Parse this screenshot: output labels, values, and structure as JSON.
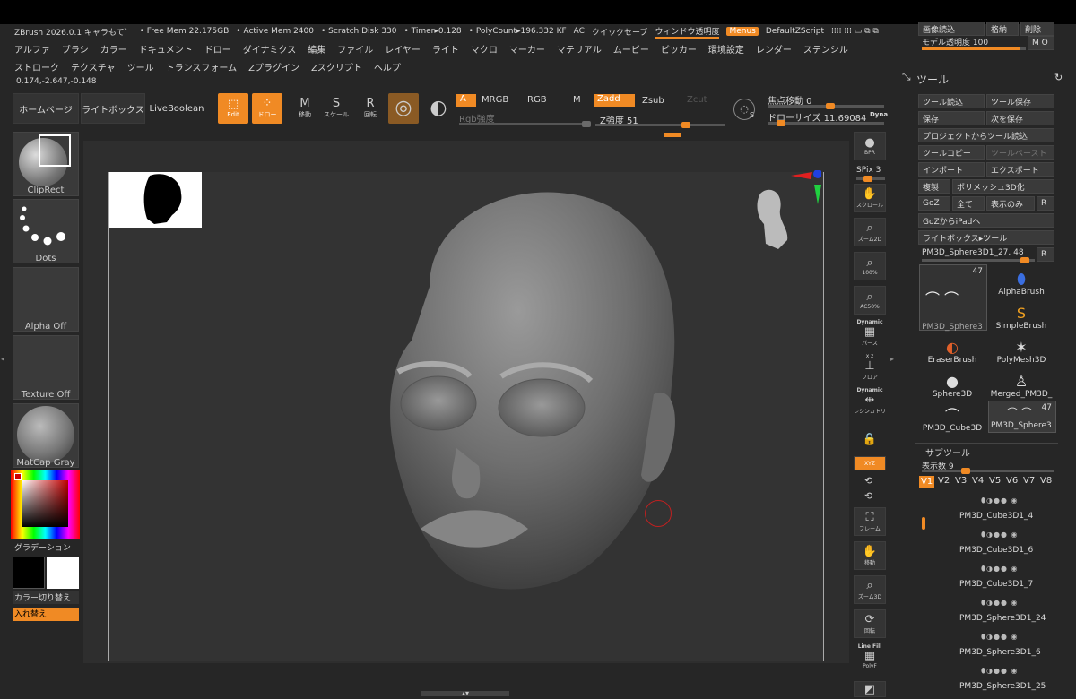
{
  "app": {
    "title": "ZBrush 2026.0.1 キャラもて゛",
    "free_mem": "• Free Mem 22.175GB",
    "active_mem": "• Active Mem 2400",
    "scratch": "• Scratch Disk 330",
    "timer": "• Timer▸0.128",
    "polycount": "• PolyCount▸196.332 KF",
    "ac": "AC",
    "quicksave": "クイックセーブ",
    "window_transparency": "ウィンドウ透明度",
    "menus": "Menus",
    "default_zscript": "DefaultZScript"
  },
  "menubar": {
    "row1": [
      "アルファ",
      "ブラシ",
      "カラー",
      "ドキュメント",
      "ドロー",
      "ダイナミクス",
      "編集",
      "ファイル",
      "レイヤー",
      "ライト",
      "マクロ",
      "マーカー",
      "マテリアル",
      "ムービー",
      "ピッカー",
      "環境設定",
      "レンダー",
      "ステンシル"
    ],
    "row2": [
      "ストローク",
      "テクスチャ",
      "ツール",
      "トランスフォーム",
      "Zプラグイン",
      "Zスクリプト",
      "ヘルプ"
    ]
  },
  "coords": "0.174,-2.647,-0.148",
  "toolbar": {
    "home": "ホームページ",
    "lightbox": "ライトボックス",
    "liveboolean": "LiveBoolean",
    "edit": "Edit",
    "draw": "ドロー",
    "move": "移動",
    "scale": "スケール",
    "rotate": "回転",
    "a": "A",
    "mrgb": "MRGB",
    "rgb": "RGB",
    "m": "M",
    "zadd": "Zadd",
    "zsub": "Zsub",
    "zcut": "Zcut",
    "rgb_intensity": "Rgb強度",
    "z_intensity": "Z強度 51",
    "focal_shift": "焦点移動 0",
    "draw_size": "ドローサイズ 11.69084",
    "dyna": "Dyna"
  },
  "left": {
    "cliprect": "ClipRect",
    "dots": "Dots",
    "alpha": "Alpha Off",
    "texture": "Texture Off",
    "matcap": "MatCap Gray",
    "gradient": "グラデーション",
    "switch_color": "カラー切り替え",
    "swap": "入れ替え"
  },
  "right_strip": {
    "bpr": "BPR",
    "spix": "SPix 3",
    "scroll": "スクロール",
    "zoom2d": "ズーム2D",
    "p100": "100%",
    "ac50": "AC50%",
    "dynamic": "Dynamic",
    "perspective": "パース",
    "floor": "フロア",
    "dynamic2": "Dynamic",
    "symmetry": "レシンカトリ",
    "xyz": "XYZ",
    "frame": "フレーム",
    "move": "移動",
    "zoom3d": "ズーム3D",
    "rotate": "回転",
    "linefill": "Line Fill",
    "polyf": "PolyF"
  },
  "side": {
    "top_buttons": [
      "画像読込",
      "格納",
      "削除"
    ],
    "model_opacity": "モデル透明度 100",
    "mo": "M O",
    "tool_title": "ツール",
    "buttons": [
      [
        "ツール読込",
        "ツール保存"
      ],
      [
        "保存",
        "次を保存"
      ],
      [
        "プロジェクトからツール読込",
        ""
      ],
      [
        "ツールコピー",
        "ツールペースト"
      ],
      [
        "インポート",
        "エクスポート"
      ]
    ],
    "dup": "複製",
    "polymesh": "ポリメッシュ3D化",
    "goz": "GoZ",
    "all": "全て",
    "visible_only": "表示のみ",
    "r": "R",
    "goz_ipad": "GoZからiPadへ",
    "lightbox_tool": "ライトボックス▸ツール",
    "current_tool": "PM3D_Sphere3D1_27. 48",
    "brush_badges": [
      "47",
      "47"
    ],
    "brushes": [
      "PM3D_Sphere3",
      "AlphaBrush",
      "SimpleBrush",
      "EraserBrush",
      "PolyMesh3D",
      "Sphere3D",
      "Merged_PM3D_",
      "PM3D_Cube3D",
      "PM3D_Sphere3"
    ],
    "subtool_title": "サブツール",
    "display_count": "表示数 9",
    "versions": [
      "V1",
      "V2",
      "V3",
      "V4",
      "V5",
      "V6",
      "V7",
      "V8"
    ],
    "subtools": [
      "PM3D_Cube3D1_4",
      "PM3D_Cube3D1_6",
      "PM3D_Cube3D1_7",
      "PM3D_Sphere3D1_24",
      "PM3D_Sphere3D1_6",
      "PM3D_Sphere3D1_25"
    ]
  },
  "colors": {
    "accent": "#f08a24",
    "panel": "#262626",
    "canvas": "#333333"
  }
}
